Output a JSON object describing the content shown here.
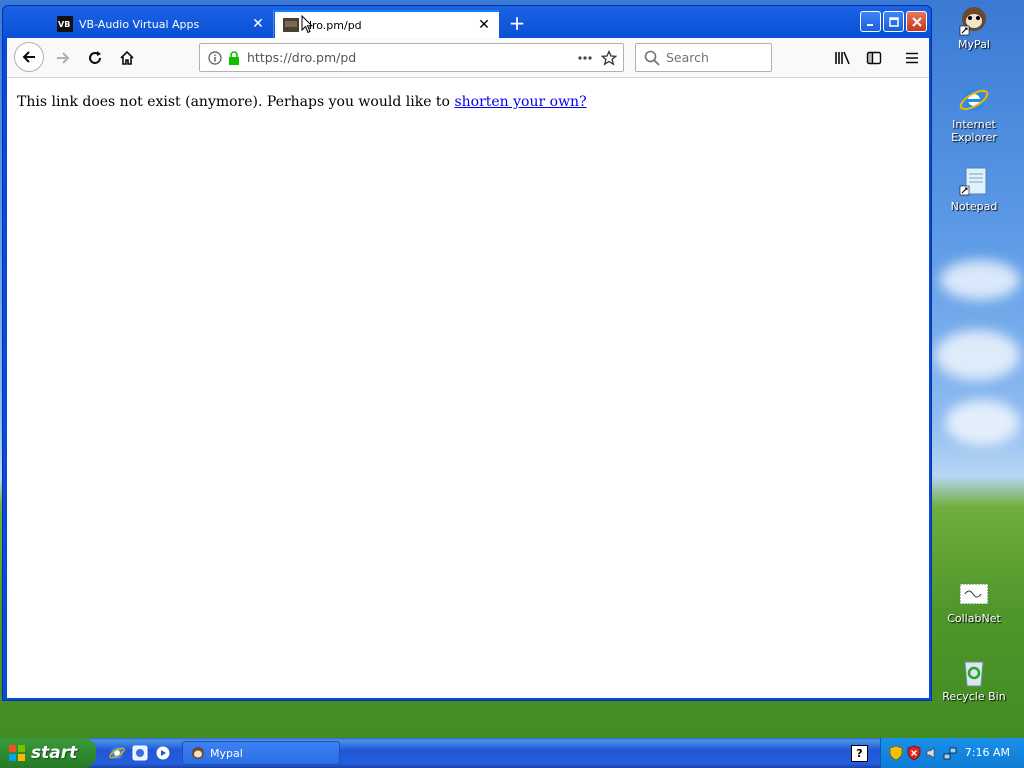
{
  "browser": {
    "tabs": [
      {
        "title": "VB-Audio Virtual Apps",
        "active": false
      },
      {
        "title": "dro.pm/pd",
        "active": true
      }
    ],
    "new_tab_symbol": "+",
    "url": "https://dro.pm/pd",
    "search_placeholder": "Search",
    "icons": [
      "back-icon",
      "forward-icon",
      "reload-icon",
      "home-icon",
      "info-icon",
      "lock-icon",
      "more-icon",
      "star-icon",
      "search-icon",
      "library-icon",
      "sidebar-icon",
      "menu-icon"
    ]
  },
  "page": {
    "message": "This link does not exist (anymore). Perhaps you would like to ",
    "link_text": "shorten your own?"
  },
  "desktop": {
    "icons": [
      {
        "label": "MyPal"
      },
      {
        "label": "Internet Explorer"
      },
      {
        "label": "Notepad"
      },
      {
        "label": "CollabNet"
      },
      {
        "label": "Recycle Bin"
      }
    ]
  },
  "taskbar": {
    "start_label": "start",
    "items": [
      {
        "label": "Mypal"
      }
    ],
    "help_symbol": "?",
    "clock": "7:16 AM"
  },
  "colors": {
    "link": "#0000ee",
    "titlebar": "#0a50d6",
    "taskbar": "#245edb",
    "start": "#2f8a2f"
  }
}
